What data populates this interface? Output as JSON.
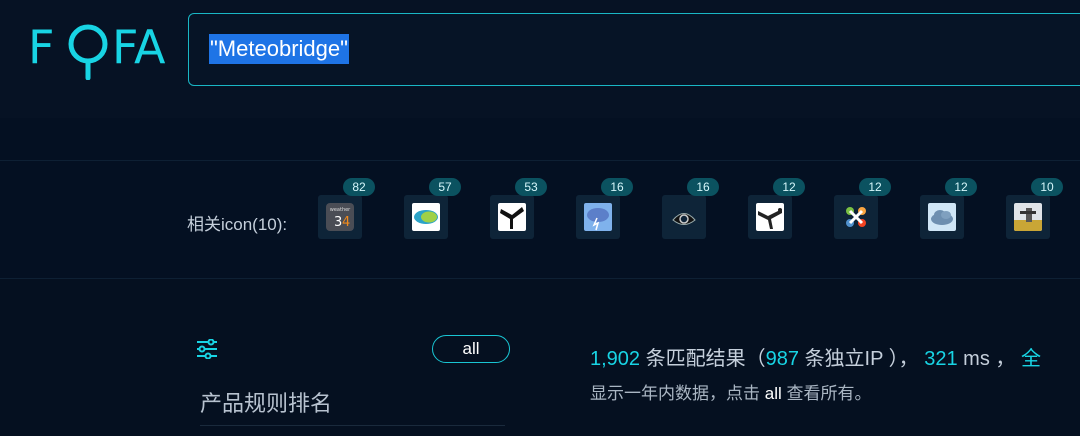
{
  "logo": {
    "part1": "F",
    "part2": "F",
    "part3": "A"
  },
  "search": {
    "value": "\"Meteobridge\""
  },
  "icons": {
    "label": "相关icon(10):",
    "items": [
      {
        "name": "weather34",
        "count": "82"
      },
      {
        "name": "meteo-green-logo",
        "count": "57"
      },
      {
        "name": "weather-station-bw",
        "count": "53"
      },
      {
        "name": "storm-cloud",
        "count": "16"
      },
      {
        "name": "eye-logo",
        "count": "16"
      },
      {
        "name": "anemometer",
        "count": "12"
      },
      {
        "name": "joomla",
        "count": "12"
      },
      {
        "name": "cloud",
        "count": "12"
      },
      {
        "name": "weather-station-photo",
        "count": "10"
      }
    ]
  },
  "sidebar": {
    "all_label": "all",
    "rank_title": "产品规则排名"
  },
  "results": {
    "count": "1,902",
    "count_label": "条匹配结果（",
    "ip_count": "987",
    "ip_label": "条独立IP ），",
    "time": "321",
    "time_unit": "ms ，",
    "cut": "全",
    "note_pre": "显示一年内数据，点击",
    "note_all": "all",
    "note_post": "查看所有。"
  },
  "colors": {
    "accent": "#18d4e4",
    "highlight": "#1e74e6",
    "background": "#051020"
  }
}
